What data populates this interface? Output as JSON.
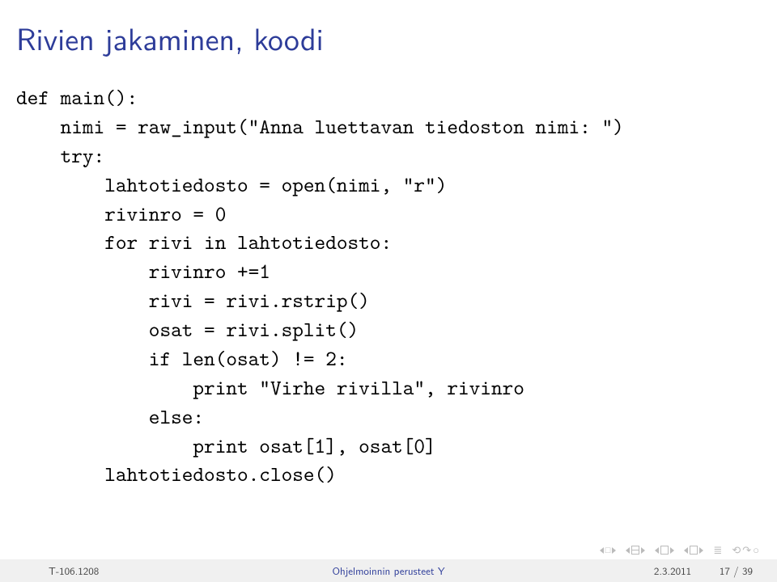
{
  "title": "Rivien jakaminen, koodi",
  "code": "def main():\n    nimi = raw_input(\"Anna luettavan tiedoston nimi: \")\n    try:\n        lahtotiedosto = open(nimi, \"r\")\n        rivinro = 0\n        for rivi in lahtotiedosto:\n            rivinro +=1\n            rivi = rivi.rstrip()\n            osat = rivi.split()\n            if len(osat) != 2:\n                print \"Virhe rivilla\", rivinro\n            else:\n                print osat[1], osat[0]\n        lahtotiedosto.close()",
  "footer": {
    "left": "T-106.1208",
    "center": "Ohjelmoinnin perusteet Y",
    "date": "2.3.2011",
    "pages": "17 / 39"
  }
}
